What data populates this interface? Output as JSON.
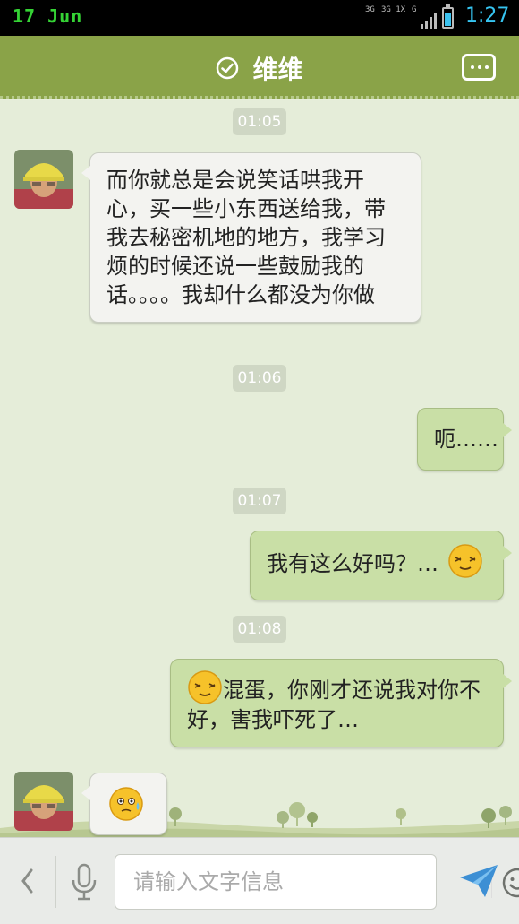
{
  "status_bar": {
    "date": "17 Jun",
    "network_1": "3G",
    "network_2": "3G 1X",
    "network_3": "G",
    "time": "1:27"
  },
  "header": {
    "title": "维维",
    "verified_icon": "check-circle-icon",
    "menu_icon": "more-dots-icon"
  },
  "messages": [
    {
      "type": "timestamp",
      "text": "01:05"
    },
    {
      "type": "received",
      "text": "而你就总是会说笑话哄我开心，买一些小东西送给我，带我去秘密机地的地方，我学习烦的时候还说一些鼓励我的话。。。。我却什么都没为你做"
    },
    {
      "type": "timestamp",
      "text": "01:06"
    },
    {
      "type": "sent",
      "text": "呃……"
    },
    {
      "type": "timestamp",
      "text": "01:07"
    },
    {
      "type": "sent",
      "text": "我有这么好吗？…",
      "emoji": "sleepy-smile-emoji"
    },
    {
      "type": "timestamp",
      "text": "01:08"
    },
    {
      "type": "sent",
      "emoji": "sleepy-smile-emoji",
      "text": "混蛋，你刚才还说我对你不好，害我吓死了…"
    },
    {
      "type": "received",
      "emoji": "nervous-sweat-emoji"
    }
  ],
  "input_bar": {
    "placeholder": "请输入文字信息",
    "icons": [
      "chevron-left-icon",
      "microphone-icon",
      "smiley-icon",
      "send-icon"
    ]
  },
  "colors": {
    "header": "#8aa348",
    "chat_background": "#e5edd9",
    "sent_bubble": "#c9dfa6",
    "received_bubble": "#f3f3f0",
    "time": "#36c5f2"
  }
}
